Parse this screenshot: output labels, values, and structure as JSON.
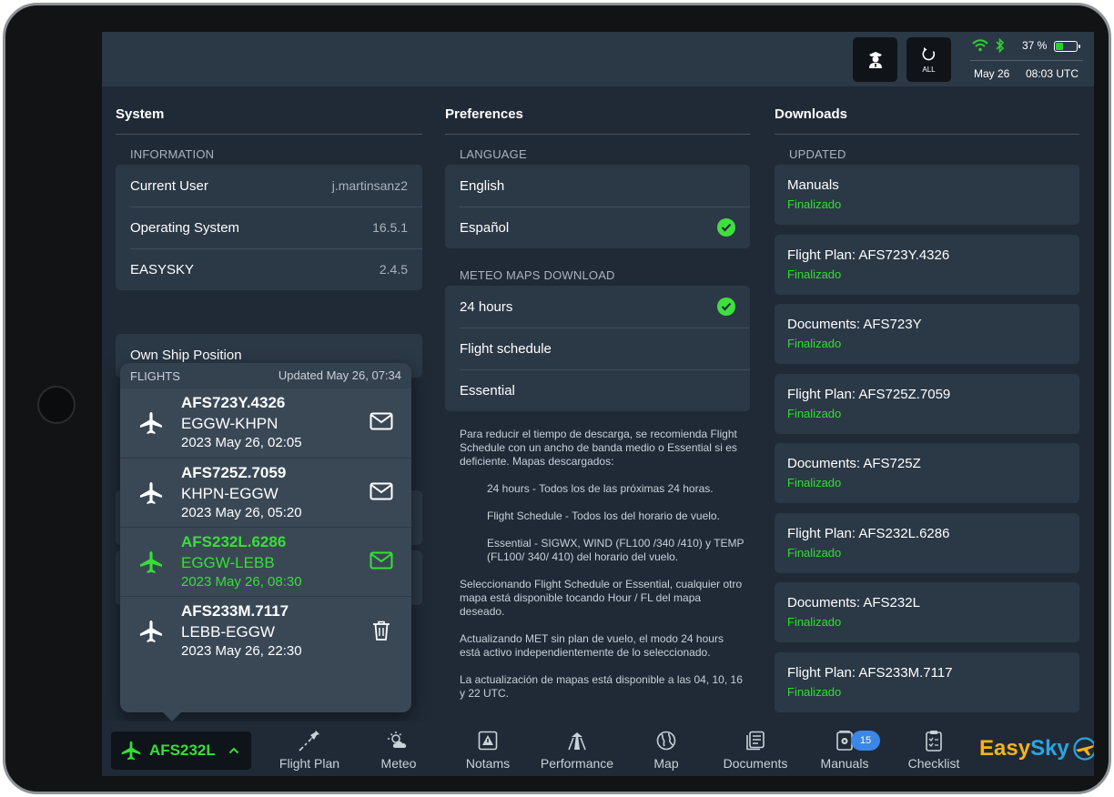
{
  "header": {
    "refresh_label": "ALL",
    "battery_percent": "37 %",
    "battery_level": 0.37,
    "date": "May 26",
    "time": "08:03 UTC"
  },
  "system": {
    "title": "System",
    "info_label": "INFORMATION",
    "rows": [
      {
        "label": "Current User",
        "value": "j.martinsanz2"
      },
      {
        "label": "Operating System",
        "value": "16.5.1"
      },
      {
        "label": "EASYSKY",
        "value": "2.4.5"
      }
    ],
    "own_ship": "Own Ship Position"
  },
  "preferences": {
    "title": "Preferences",
    "language_label": "LANGUAGE",
    "languages": [
      "English",
      "Español"
    ],
    "selected_language": "Español",
    "meteo_label": "METEO MAPS DOWNLOAD",
    "meteo_options": [
      "24 hours",
      "Flight schedule",
      "Essential"
    ],
    "selected_meteo": "24 hours",
    "notes": {
      "intro": "Para reducir el tiempo de descarga, se recomienda Flight Schedule con un ancho de banda medio o Essential si es deficiente. Mapas descargados:",
      "item1": "24 hours - Todos los de las próximas 24 horas.",
      "item2": "Flight Schedule - Todos los del horario de vuelo.",
      "item3": "Essential - SIGWX, WIND (FL100 /340 /410) y TEMP (FL100/ 340/ 410) del horario del vuelo.",
      "p2": "Seleccionando Flight Schedule or Essential, cualquier otro mapa está disponible tocando Hour / FL del mapa deseado.",
      "p3": "Actualizando MET sin plan de vuelo, el modo 24 hours está activo independientemente de lo seleccionado.",
      "p4": "La actualización de mapas está disponible a las 04, 10, 16 y 22 UTC."
    }
  },
  "downloads": {
    "title": "Downloads",
    "updated_label": "UPDATED",
    "items": [
      {
        "name": "Manuals",
        "status": "Finalizado"
      },
      {
        "name": "Flight Plan: AFS723Y.4326",
        "status": "Finalizado"
      },
      {
        "name": "Documents: AFS723Y",
        "status": "Finalizado"
      },
      {
        "name": "Flight Plan: AFS725Z.7059",
        "status": "Finalizado"
      },
      {
        "name": "Documents: AFS725Z",
        "status": "Finalizado"
      },
      {
        "name": "Flight Plan: AFS232L.6286",
        "status": "Finalizado"
      },
      {
        "name": "Documents: AFS232L",
        "status": "Finalizado"
      },
      {
        "name": "Flight Plan: AFS233M.7117",
        "status": "Finalizado"
      }
    ]
  },
  "flights_popover": {
    "title": "FLIGHTS",
    "updated": "Updated May 26, 07:34",
    "flights": [
      {
        "code": "AFS723Y.4326",
        "route": "EGGW-KHPN",
        "when": "2023 May 26, 02:05",
        "action": "mail-icon",
        "active": false
      },
      {
        "code": "AFS725Z.7059",
        "route": "KHPN-EGGW",
        "when": "2023 May 26, 05:20",
        "action": "mail-icon",
        "active": false
      },
      {
        "code": "AFS232L.6286",
        "route": "EGGW-LEBB",
        "when": "2023 May 26, 08:30",
        "action": "mail-icon",
        "active": true
      },
      {
        "code": "AFS233M.7117",
        "route": "LEBB-EGGW",
        "when": "2023 May 26, 22:30",
        "action": "trash-icon",
        "active": false
      }
    ]
  },
  "bottombar": {
    "current_flight": "AFS232L",
    "tabs": [
      {
        "label": "Flight Plan",
        "icon": "flight-plan-icon"
      },
      {
        "label": "Meteo",
        "icon": "weather-icon"
      },
      {
        "label": "Notams",
        "icon": "notams-icon"
      },
      {
        "label": "Performance",
        "icon": "performance-icon"
      },
      {
        "label": "Map",
        "icon": "globe-icon"
      },
      {
        "label": "Documents",
        "icon": "documents-icon"
      },
      {
        "label": "Manuals",
        "icon": "manuals-icon",
        "badge": "15"
      },
      {
        "label": "Checklist",
        "icon": "checklist-icon"
      }
    ],
    "logo_easy": "Easy",
    "logo_sky": "Sky"
  },
  "colors": {
    "accent_green": "#35e035",
    "background": "#1f2a36",
    "card": "#2b3846",
    "badge_blue": "#3b86e6"
  }
}
